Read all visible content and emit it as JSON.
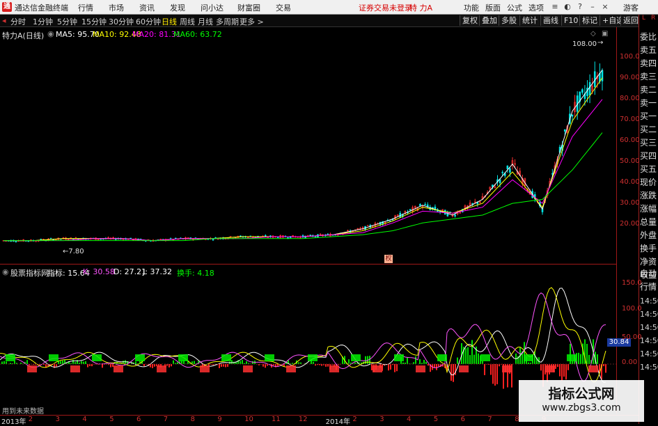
{
  "app": {
    "title": "通达信金融终端",
    "logo": "通"
  },
  "menu": [
    "行情",
    "市场",
    "资讯",
    "发现",
    "问小达",
    "财富圈",
    "交易"
  ],
  "status": {
    "login": "证券交易未登录",
    "stock": "特 力A"
  },
  "right_menu": [
    "功能",
    "版面",
    "公式",
    "选项"
  ],
  "window_label": "游客",
  "periods": [
    "分时",
    "1分钟",
    "5分钟",
    "15分钟",
    "30分钟",
    "60分钟",
    "日线",
    "周线",
    "月线",
    "多周期",
    "更多 >"
  ],
  "active_period": "日线",
  "toolbar": [
    "复权",
    "叠加",
    "多股",
    "统计",
    "画线",
    "F10",
    "标记",
    "+自选",
    "返回"
  ],
  "right_tabs": [
    "委比",
    "卖五",
    "卖四",
    "卖三",
    "卖二",
    "卖一",
    "买一",
    "买二",
    "买三",
    "买四",
    "买五",
    "现价",
    "涨跌",
    "涨幅",
    "总量",
    "外盘",
    "换手",
    "净资",
    "收益"
  ],
  "right_tabs_bottom": [
    "自动",
    "行情"
  ],
  "chart_title": {
    "name": "特力A",
    "period": "(日线)"
  },
  "ma": [
    {
      "label": "MA5: 95.70",
      "color": "#ffffff"
    },
    {
      "label": "MA10: 92.48",
      "color": "#ffff00"
    },
    {
      "label": "MA20: 81.31",
      "color": "#ff00ff"
    },
    {
      "label": "MA60: 63.72",
      "color": "#00ff00"
    }
  ],
  "indicator": {
    "name": "股票指标网",
    "label_prefix": "指标:",
    "values": [
      {
        "label": "指标: 15.64",
        "color": "#ffffff"
      },
      {
        "label": "K: 30.58",
        "color": "#ff55ff"
      },
      {
        "label": "D: 27.21",
        "color": "#ffffff"
      },
      {
        "label": "J: 37.32",
        "color": "#ffffff"
      },
      {
        "label": "换手: 4.18",
        "color": "#00ff00"
      }
    ]
  },
  "price_axis": [
    "100.0",
    "90.00",
    "80.00",
    "70.00",
    "60.00",
    "50.00",
    "40.00",
    "30.00",
    "20.00"
  ],
  "indicator_axis": [
    "150.0",
    "100.0",
    "50.00",
    "0.00"
  ],
  "indicator_current": "30.84",
  "time_labels": [
    "14:50",
    "14:50",
    "14:50",
    "14:50",
    "14:50",
    "14:50"
  ],
  "annotations": {
    "high": "108.00",
    "low": "7.80",
    "note": "用到未来数据",
    "weight_marker": "权"
  },
  "x_ticks": [
    "2013年",
    "2",
    "3",
    "4",
    "5",
    "6",
    "7",
    "8",
    "9",
    "10",
    "11",
    "12",
    "2014年",
    "2",
    "3",
    "4",
    "5",
    "6",
    "7",
    "8",
    "9"
  ],
  "watermark": {
    "title": "指标公式网",
    "url": "www.zbgs3.com"
  },
  "chart_data": {
    "type": "line",
    "x": [
      "2013-01",
      "2013-02",
      "2013-03",
      "2013-04",
      "2013-05",
      "2013-06",
      "2013-07",
      "2013-08",
      "2013-09",
      "2013-10",
      "2013-11",
      "2013-12",
      "2014-01",
      "2014-02",
      "2014-03",
      "2014-04",
      "2014-05",
      "2014-06",
      "2014-07",
      "2014-08",
      "2014-09"
    ],
    "series": [
      {
        "name": "MA5",
        "values": [
          9,
          9,
          10,
          10,
          10,
          9,
          10,
          10,
          11,
          11,
          11,
          12,
          15,
          20,
          27,
          22,
          30,
          48,
          25,
          75,
          96
        ]
      },
      {
        "name": "MA10",
        "values": [
          9,
          9,
          10,
          10,
          10,
          9,
          10,
          10,
          11,
          11,
          11,
          12,
          14,
          19,
          26,
          23,
          28,
          44,
          26,
          70,
          92
        ]
      },
      {
        "name": "MA20",
        "values": [
          9,
          9,
          9,
          10,
          10,
          9,
          10,
          10,
          10,
          11,
          11,
          12,
          13,
          18,
          24,
          23,
          26,
          40,
          28,
          62,
          81
        ]
      },
      {
        "name": "MA60",
        "values": [
          9,
          9,
          9,
          9,
          9,
          9,
          9,
          10,
          10,
          10,
          10,
          11,
          12,
          14,
          18,
          20,
          22,
          28,
          30,
          45,
          64
        ]
      }
    ],
    "ylim": [
      0,
      110
    ],
    "grid": false
  }
}
